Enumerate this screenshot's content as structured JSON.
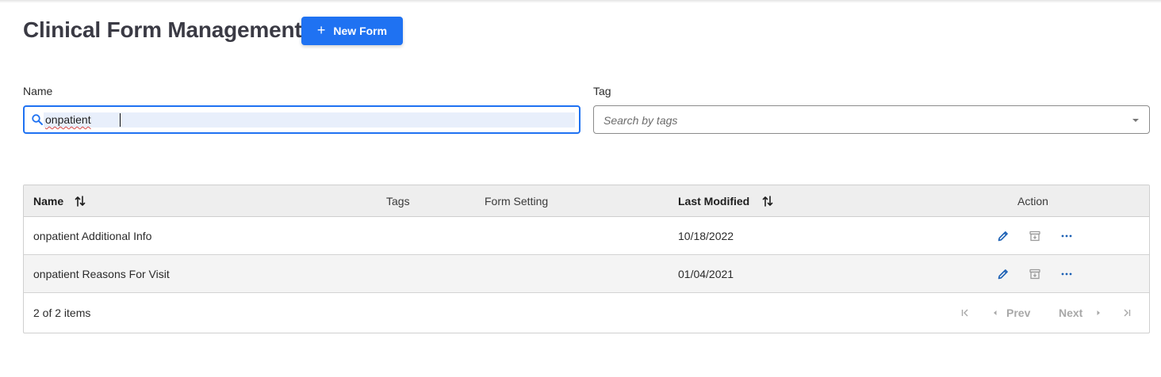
{
  "header": {
    "title": "Clinical Form Management",
    "new_button_label": "New Form"
  },
  "filters": {
    "name_label": "Name",
    "name_value": "onpatient",
    "tag_label": "Tag",
    "tag_placeholder": "Search by tags"
  },
  "table": {
    "columns": [
      "Name",
      "Tags",
      "Form Setting",
      "Last Modified",
      "Action"
    ],
    "rows": [
      {
        "name": "onpatient Additional Info",
        "tags": "",
        "form_setting": "",
        "last_modified": "10/18/2022"
      },
      {
        "name": "onpatient Reasons For Visit",
        "tags": "",
        "form_setting": "",
        "last_modified": "01/04/2021"
      }
    ],
    "row_actions": [
      "edit-icon",
      "archive-icon",
      "more-icon"
    ],
    "footer": {
      "count": "2 of 2 items",
      "prev": "Prev",
      "next": "Next"
    }
  },
  "colors": {
    "primary": "#1f72f2",
    "action_icon": "#1a5fb4",
    "disabled": "#a8a8a8",
    "header_bg": "#eeeeee"
  }
}
